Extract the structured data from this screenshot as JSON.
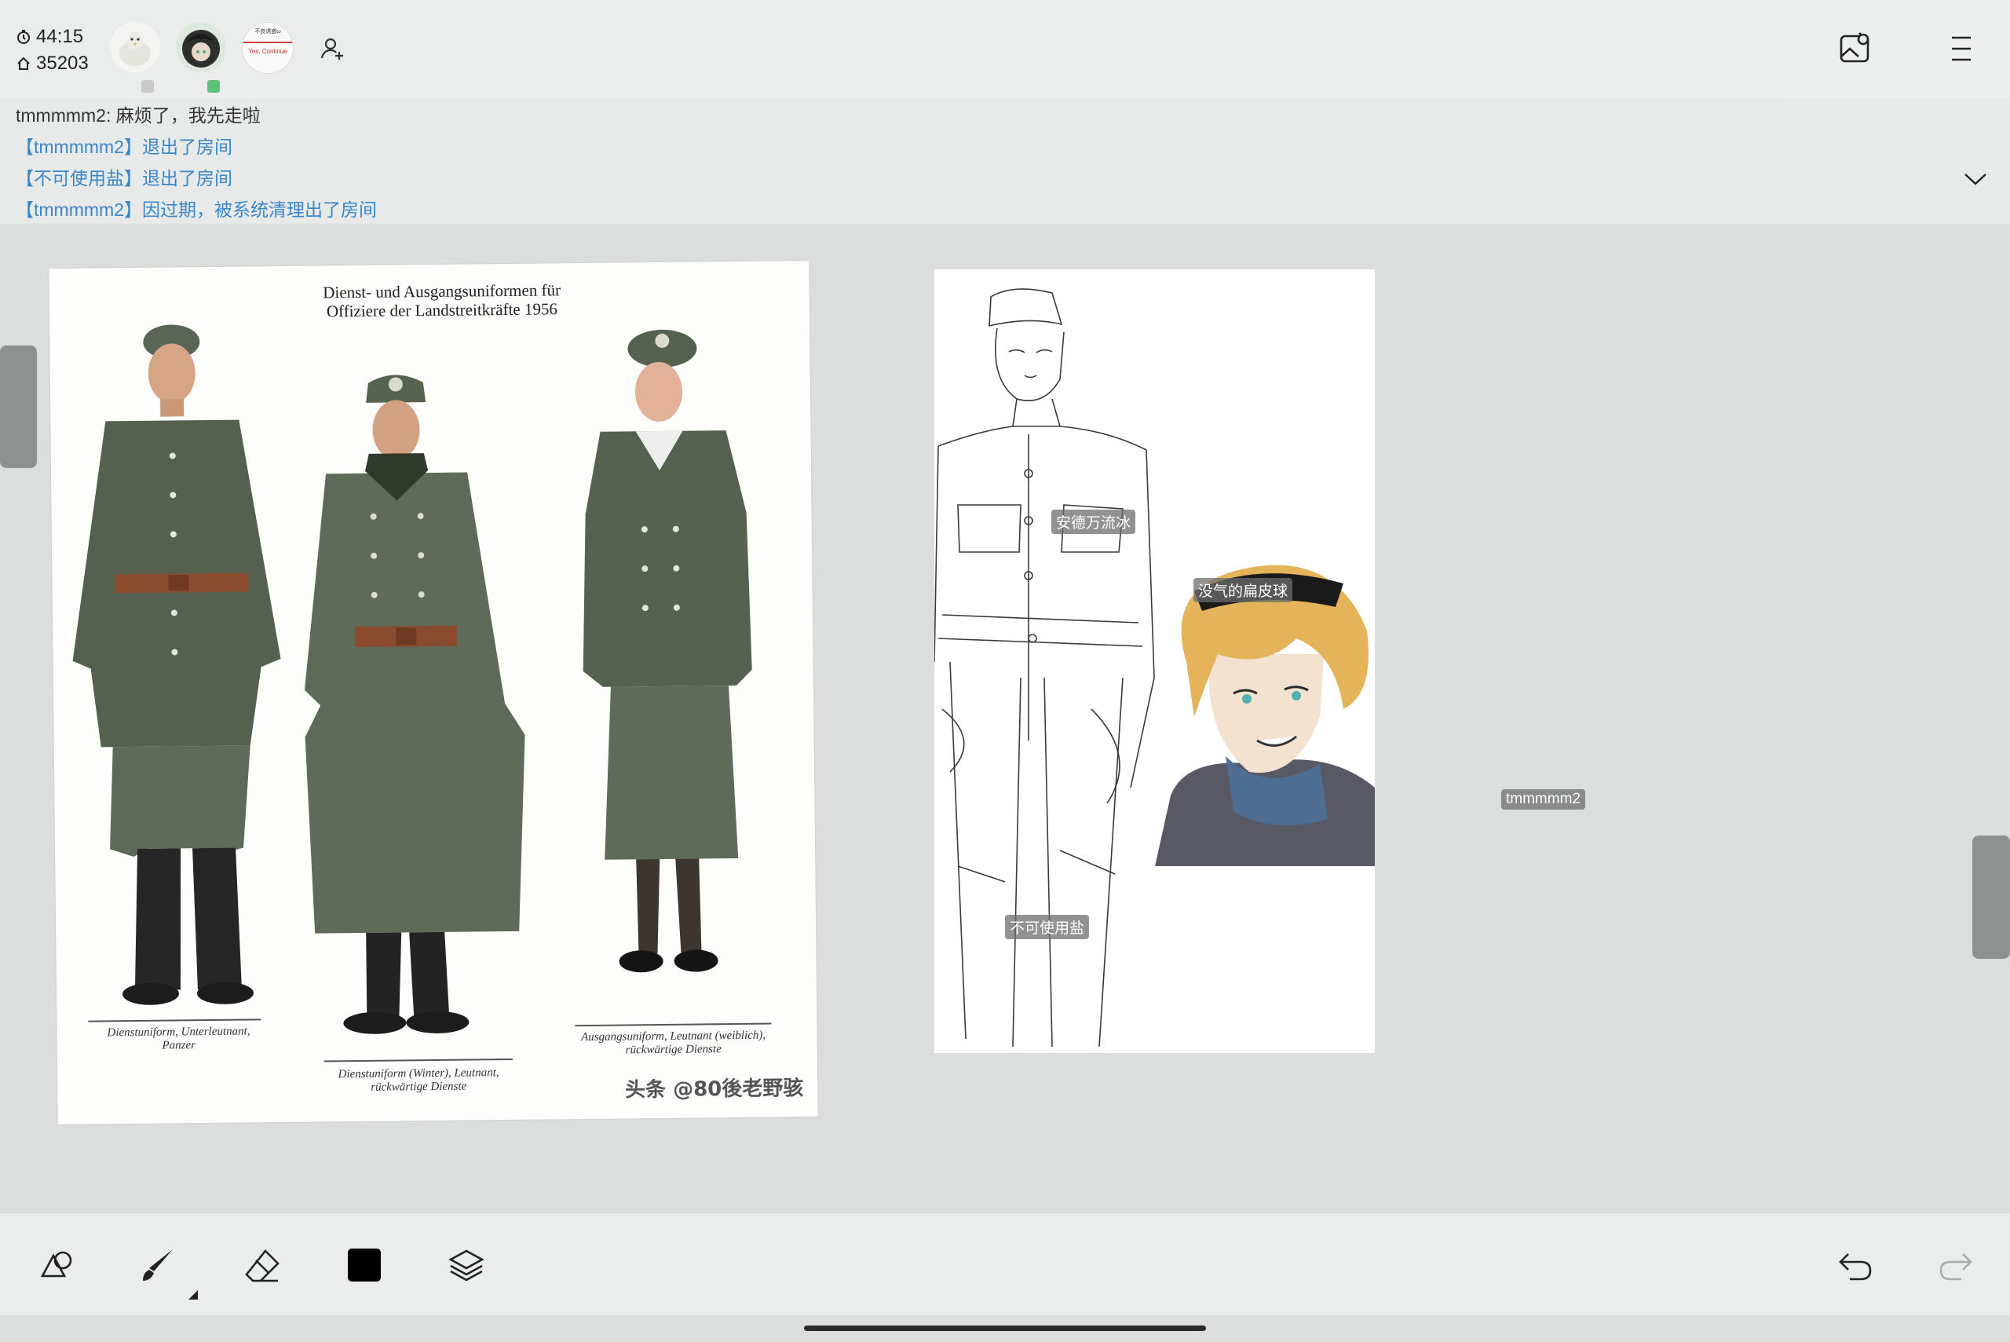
{
  "status": {
    "timer": "44:15",
    "room_number": "35203"
  },
  "participants": [
    {
      "name": "avatar-1",
      "badge_color": "#c9c9c9"
    },
    {
      "name": "avatar-2",
      "badge_color": "#5ec27a"
    },
    {
      "name": "avatar-3",
      "avatar_text_top": "不良诱惑ω",
      "avatar_text": "Yes, Continue",
      "badge_color": null
    }
  ],
  "chat": {
    "messages": [
      {
        "type": "user",
        "text": "tmmmmm2:  麻烦了，我先走啦"
      },
      {
        "type": "system",
        "text": "【tmmmmm2】退出了房间"
      },
      {
        "type": "system",
        "text": "【不可使用盐】退出了房间"
      },
      {
        "type": "system",
        "text": "【tmmmmm2】因过期，被系统清理出了房间"
      }
    ]
  },
  "reference_image": {
    "title_line1": "Dienst- und Ausgangsuniformen für",
    "title_line2": "Offiziere der Landstreitkräfte 1956",
    "captions": [
      {
        "line1": "Dienstuniform, Unterleutnant,",
        "line2": "Panzer"
      },
      {
        "line1": "Dienstuniform (Winter), Leutnant,",
        "line2": "rückwärtige Dienste"
      },
      {
        "line1": "Ausgangsuniform, Leutnant (weiblich),",
        "line2": "rückwärtige Dienste"
      }
    ],
    "watermark": "头条 @80後老野骇"
  },
  "cursors": [
    {
      "label": "安德万流冰"
    },
    {
      "label": "没气的扁皮球"
    },
    {
      "label": "不可使用盐"
    },
    {
      "label": "tmmmmm2"
    }
  ],
  "colors": {
    "accent": "#3a86c8",
    "topbar_bg": "#ebeded",
    "canvas_bg": "#dcdedd"
  },
  "icons": {
    "timer": "clock-icon",
    "room": "home-icon",
    "add_user": "add-user-icon",
    "gallery": "gallery-icon",
    "menu": "menu-icon",
    "collapse": "chevron-down-icon",
    "tools": [
      "shape-tool-icon",
      "brush-icon",
      "eraser-icon",
      "color-swatch-icon",
      "layers-icon"
    ],
    "undo": "undo-icon",
    "redo": "redo-icon"
  }
}
